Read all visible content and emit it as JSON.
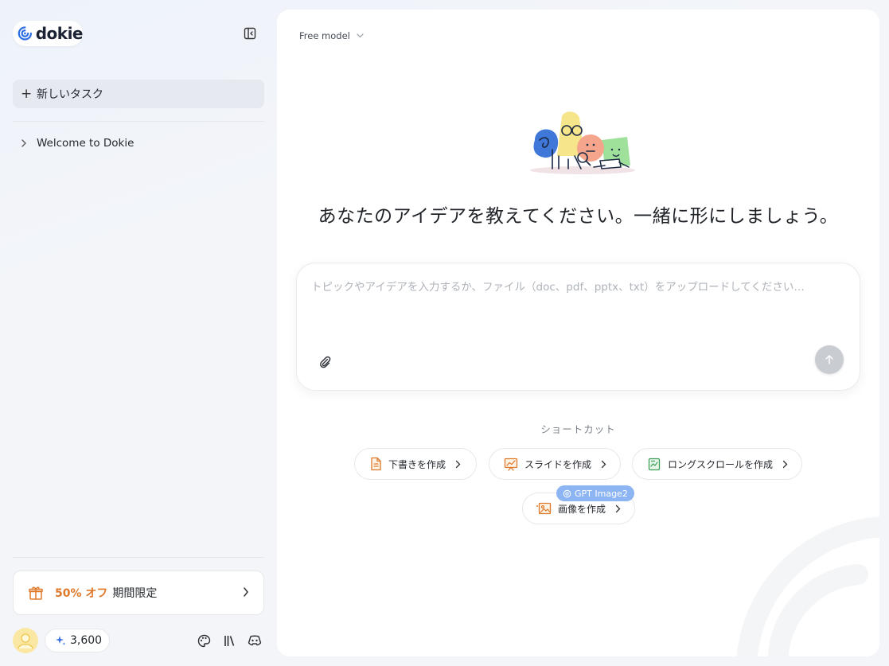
{
  "brand": {
    "logo_text": "dokie"
  },
  "sidebar": {
    "new_task_label": "新しいタスク",
    "folders": [
      {
        "label": "Welcome to Dokie"
      }
    ],
    "promo": {
      "discount": "50% オフ",
      "label": "期間限定"
    },
    "credits": "3,600"
  },
  "main": {
    "model_label": "Free model",
    "hero_title": "あなたのアイデアを教えてください。一緒に形にしましょう。",
    "composer_placeholder": "トピックやアイデアを入力するか、ファイル（doc、pdf、pptx、txt）をアップロードしてください…",
    "shortcuts_label": "ショートカット",
    "shortcuts": [
      {
        "label": "下書きを作成",
        "icon": "document-icon"
      },
      {
        "label": "スライドを作成",
        "icon": "slides-icon"
      },
      {
        "label": "ロングスクロールを作成",
        "icon": "long-scroll-icon"
      },
      {
        "label": "画像を作成",
        "icon": "image-icon",
        "badge": "GPT Image2"
      }
    ]
  },
  "colors": {
    "accent_orange": "#e0782a",
    "badge_blue": "#8db4f3",
    "logo_blue": "#2f6fe4"
  }
}
